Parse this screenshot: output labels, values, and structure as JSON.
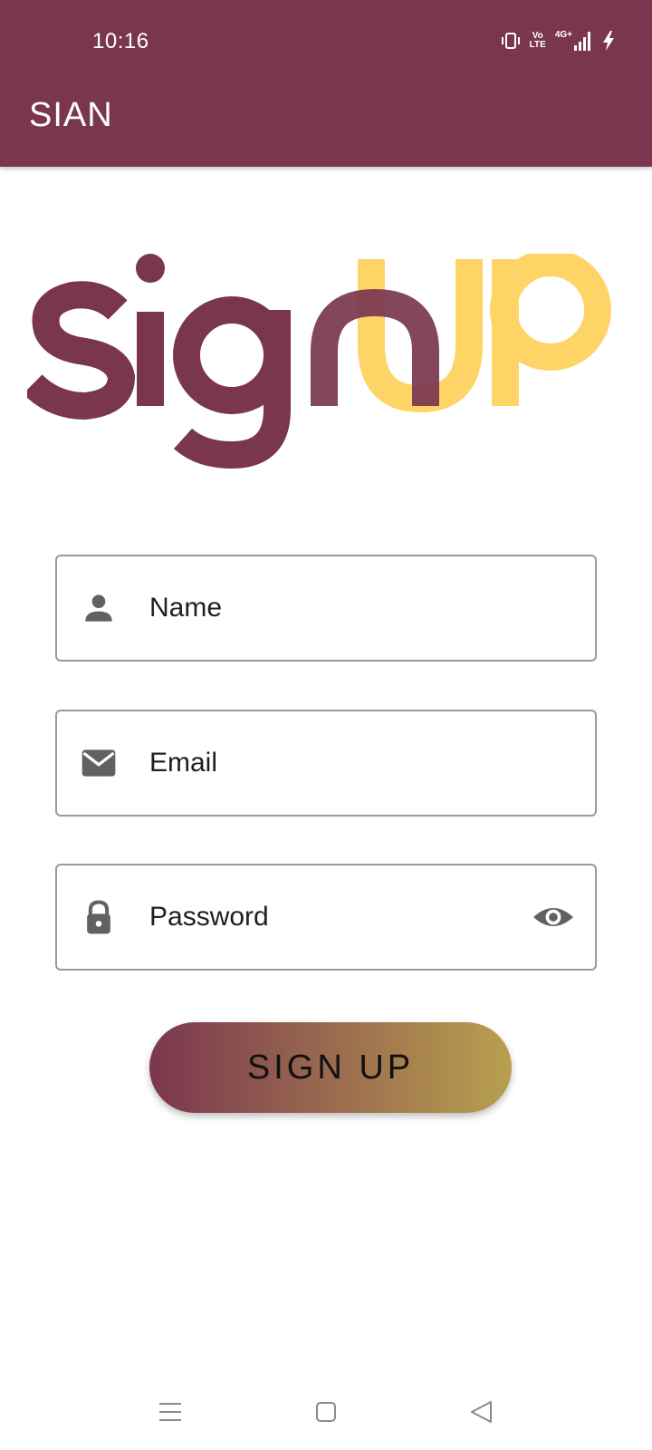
{
  "status_bar": {
    "time": "10:16",
    "volte_top": "Vo",
    "volte_bottom": "LTE",
    "network": "4G+",
    "icons": [
      "vibrate-icon",
      "volte-icon",
      "signal-icon",
      "charging-icon"
    ]
  },
  "app_bar": {
    "title": "SIAN"
  },
  "logo": {
    "text": "signup",
    "primary_color": "#7a364f",
    "accent_color": "#ffd466"
  },
  "form": {
    "fields": [
      {
        "label": "Name",
        "icon": "person-icon"
      },
      {
        "label": "Email",
        "icon": "mail-icon"
      },
      {
        "label": "Password",
        "icon": "lock-icon",
        "trailing_icon": "eye-icon"
      }
    ],
    "submit_label": "SIGN UP"
  },
  "nav_bar": {
    "buttons": [
      "menu-icon",
      "home-square-icon",
      "back-triangle-icon"
    ]
  },
  "colors": {
    "primary": "#7a364f",
    "accent": "#ffd466",
    "button_gradient_end": "#b8a04e",
    "field_border": "#9a9a9a",
    "icon_gray": "#616161"
  }
}
